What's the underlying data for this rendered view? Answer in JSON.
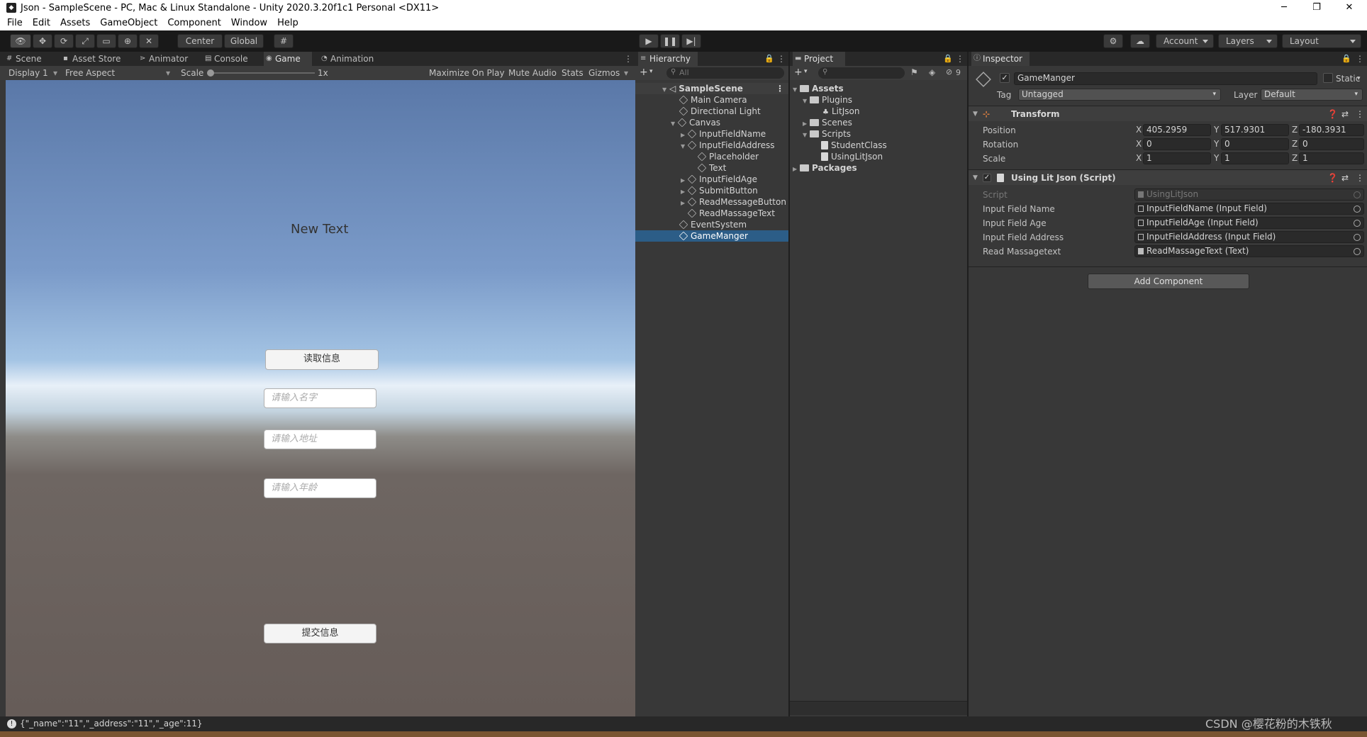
{
  "window": {
    "title": "Json - SampleScene - PC, Mac & Linux Standalone - Unity 2020.3.20f1c1 Personal <DX11>",
    "minimize": "─",
    "maximize": "❐",
    "close": "✕"
  },
  "menu": [
    "File",
    "Edit",
    "Assets",
    "GameObject",
    "Component",
    "Window",
    "Help"
  ],
  "toolbar": {
    "pivot": "Center",
    "space": "Global",
    "account": "Account",
    "layers": "Layers",
    "layout": "Layout"
  },
  "left_tabs": [
    "Scene",
    "Asset Store",
    "Animator",
    "Console",
    "Game",
    "Animation"
  ],
  "game_bar": {
    "display": "Display 1",
    "aspect": "Free Aspect",
    "scale_label": "Scale",
    "scale_value": "1x",
    "maximize": "Maximize On Play",
    "mute": "Mute Audio",
    "stats": "Stats",
    "gizmos": "Gizmos"
  },
  "game_view": {
    "text": "New Text",
    "read_button": "读取信息",
    "name_placeholder": "请输入名字",
    "address_placeholder": "请输入地址",
    "age_placeholder": "请输入年龄",
    "submit_button": "提交信息"
  },
  "hierarchy": {
    "tab": "Hierarchy",
    "search_placeholder": "All",
    "items": [
      "SampleScene",
      "Main Camera",
      "Directional Light",
      "Canvas",
      "InputFieldName",
      "InputFieldAddress",
      "Placeholder",
      "Text",
      "InputFieldAge",
      "SubmitButton",
      "ReadMessageButton",
      "ReadMassageText",
      "EventSystem",
      "GameManger"
    ],
    "selected": "GameManger"
  },
  "project": {
    "tab": "Project",
    "hidden_count": "9",
    "items": [
      "Assets",
      "Plugins",
      "LitJson",
      "Scenes",
      "Scripts",
      "StudentClass",
      "UsingLitJson",
      "Packages"
    ]
  },
  "inspector": {
    "tab": "Inspector",
    "object_name": "GameManger",
    "static": "Static",
    "tag_label": "Tag",
    "tag": "Untagged",
    "layer_label": "Layer",
    "layer": "Default",
    "transform": {
      "title": "Transform",
      "position_label": "Position",
      "rotation_label": "Rotation",
      "scale_label": "Scale",
      "position": [
        "405.2959",
        "517.9301",
        "-180.3931"
      ],
      "rotation": [
        "0",
        "0",
        "0"
      ],
      "scale": [
        "1",
        "1",
        "1"
      ]
    },
    "script_component": {
      "title": "Using Lit Json (Script)",
      "fields": [
        {
          "label": "Script",
          "value": "UsingLitJson"
        },
        {
          "label": "Input Field Name",
          "value": "InputFieldName (Input Field)"
        },
        {
          "label": "Input Field Age",
          "value": "InputFieldAge (Input Field)"
        },
        {
          "label": "Input Field Address",
          "value": "InputFieldAddress (Input Field)"
        },
        {
          "label": "Read Massagetext",
          "value": "ReadMassageText (Text)"
        }
      ]
    },
    "add_component": "Add Component"
  },
  "status": {
    "message": "{\"_name\":\"11\",\"_address\":\"11\",\"_age\":11}",
    "watermark": "CSDN @樱花粉的木铁秋"
  }
}
